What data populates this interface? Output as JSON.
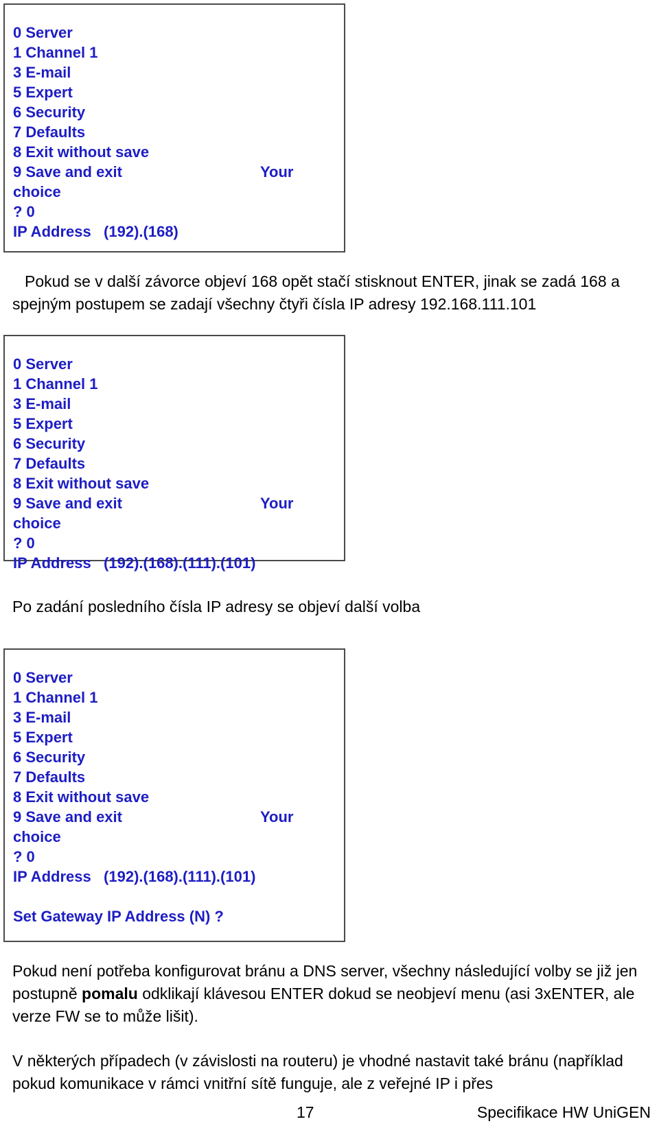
{
  "document": {
    "page_number": "17",
    "footer_title": "Specifikace HW UniGEN"
  },
  "colors": {
    "terminal_text": "#1d1dc4",
    "body_text": "#000000",
    "box_border": "#4a4a4a",
    "background": "#ffffff"
  },
  "terminal_menu": {
    "items": [
      "0 Server",
      "1 Channel 1",
      "3 E-mail",
      "5 Expert",
      "6 Security",
      "7 Defaults",
      "8 Exit without save",
      "9 Save and exit"
    ],
    "your_label": "Your",
    "choice_label": "choice",
    "prompt_line": "? 0"
  },
  "screenshots": [
    {
      "id": "terminal-screenshot-1",
      "ip_line": "IP Address   (192).(168)"
    },
    {
      "id": "terminal-screenshot-2",
      "ip_line": "IP Address   (192).(168).(111).(101)"
    },
    {
      "id": "terminal-screenshot-3",
      "ip_line": "IP Address   (192).(168).(111).(101)",
      "gateway_prompt": "Set Gateway IP Address (N) ?"
    }
  ],
  "paragraphs": {
    "p1_a": "Pokud se v další závorce objeví 168 opět stačí stisknout ENTER, jinak se zadá 168 a spejným postupem se zadají všechny čtyři čísla IP adresy 192.168.111.101",
    "p2": "Po zadání posledního čísla IP adresy se objeví další volba",
    "p3_before": "Pokud není potřeba konfigurovat bránu a DNS server, všechny následující volby se již jen postupně ",
    "p3_bold": "pomalu",
    "p3_after": " odklikají klávesou ENTER dokud se neobjeví menu (asi 3xENTER, ale verze FW se to může lišit).",
    "p4": "V některých případech (v závislosti na routeru) je vhodné nastavit také bránu (například pokud komunikace v rámci vnitřní sítě funguje, ale z veřejné IP i přes"
  }
}
